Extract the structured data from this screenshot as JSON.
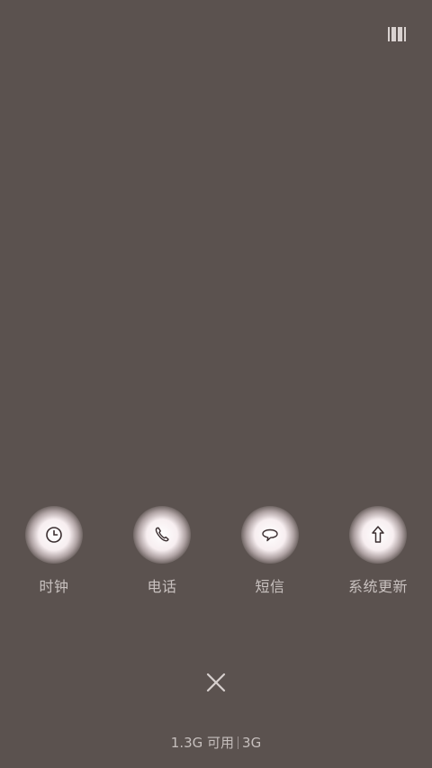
{
  "apps": [
    {
      "label": "时钟",
      "icon": "clock-icon"
    },
    {
      "label": "电话",
      "icon": "phone-icon"
    },
    {
      "label": "短信",
      "icon": "message-icon"
    },
    {
      "label": "系统更新",
      "icon": "update-arrow-icon"
    }
  ],
  "status": {
    "memory": "1.3G 可用",
    "network": "3G"
  },
  "colors": {
    "background": "#5b524f",
    "glow": "#f7eef0",
    "text": "#c8c1bf"
  }
}
